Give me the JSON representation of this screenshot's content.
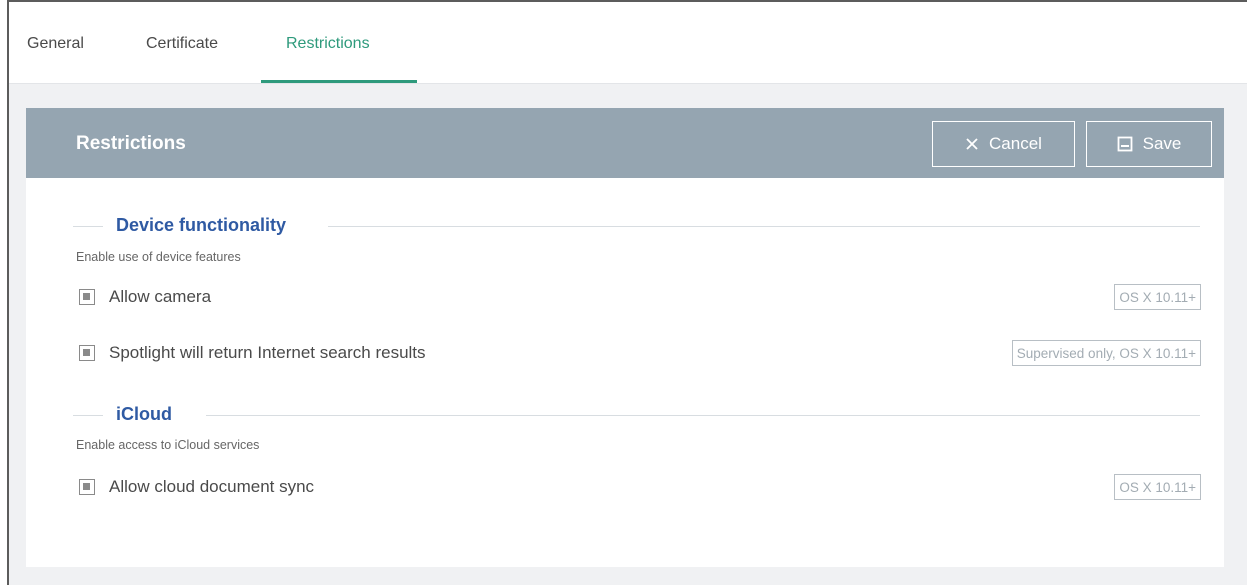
{
  "tabs": [
    {
      "label": "General"
    },
    {
      "label": "Certificate"
    },
    {
      "label": "Restrictions"
    }
  ],
  "active_tab": "Restrictions",
  "panel": {
    "title": "Restrictions",
    "cancel_label": "Cancel",
    "save_label": "Save"
  },
  "sections": [
    {
      "title": "Device functionality",
      "subtitle": "Enable use of device features",
      "items": [
        {
          "label": "Allow camera",
          "badge": "OS X 10.11+"
        },
        {
          "label": "Spotlight will return Internet search results",
          "badge": "Supervised only, OS X 10.11+"
        }
      ]
    },
    {
      "title": "iCloud",
      "subtitle": "Enable access to iCloud services",
      "items": [
        {
          "label": "Allow cloud document sync",
          "badge": "OS X 10.11+"
        }
      ]
    }
  ],
  "colors": {
    "accent": "#2e9a7c",
    "header": "#95a5b1",
    "section_title": "#2f5aa3"
  },
  "icons": {
    "cancel": "close-icon",
    "save": "save-icon",
    "checkbox": "checkbox-indeterminate"
  }
}
